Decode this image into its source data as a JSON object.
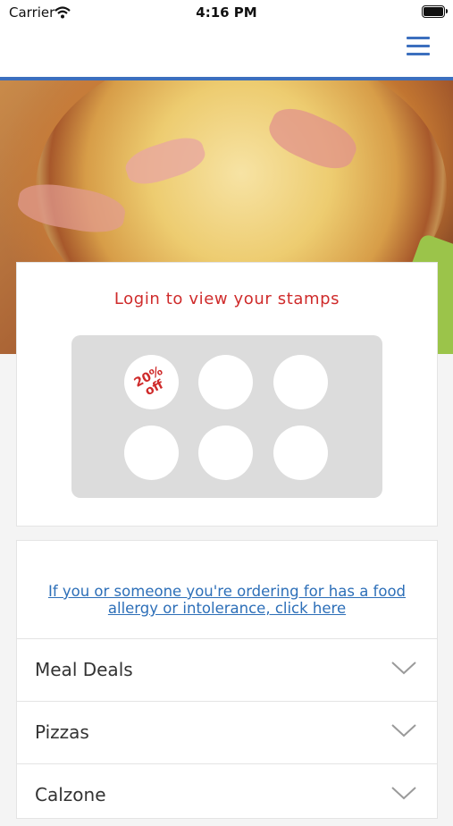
{
  "status_bar": {
    "carrier": "Carrier",
    "time": "4:16 PM"
  },
  "stamps": {
    "title": "Login to view your stamps",
    "reward_label": "20%\noff"
  },
  "allergy": {
    "link_text": "If you or someone you're ordering for has a food allergy or intolerance, click here"
  },
  "categories": [
    {
      "label": "Meal Deals"
    },
    {
      "label": "Pizzas"
    },
    {
      "label": "Calzone"
    }
  ],
  "colors": {
    "accent": "#3c6fbe",
    "stamp_title": "#cf2b2b",
    "link": "#2d6fb8"
  },
  "icons": {
    "menu": "hamburger-menu-icon",
    "expand": "chevron-down-icon"
  }
}
